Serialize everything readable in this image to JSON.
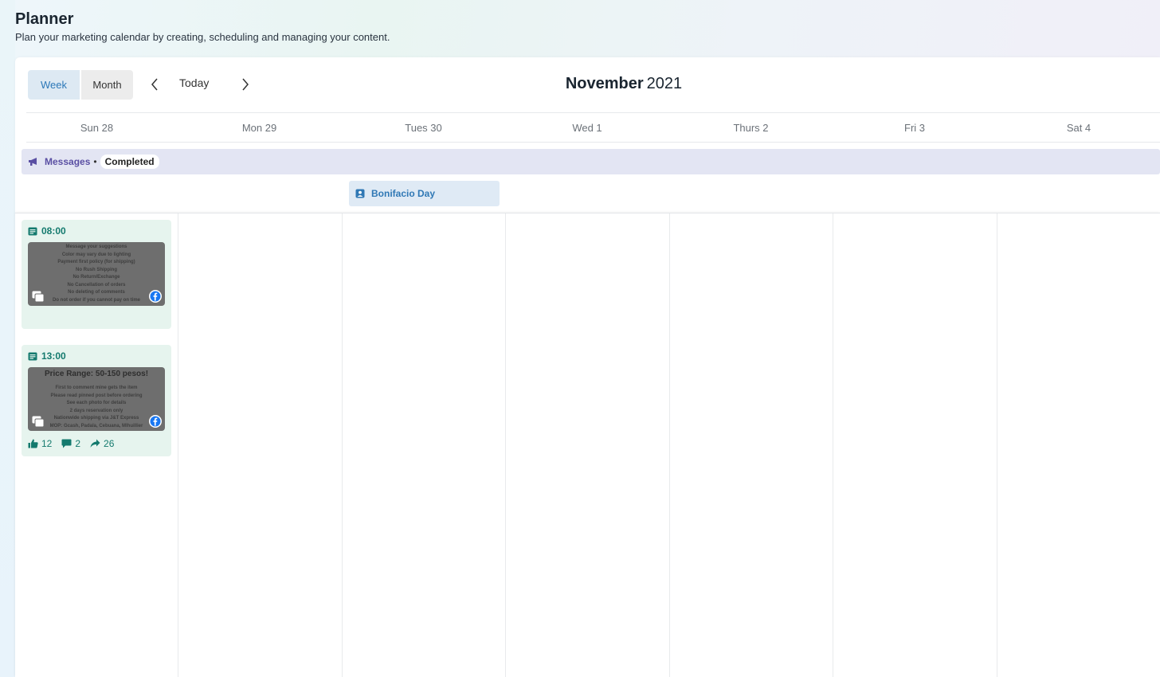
{
  "header": {
    "title": "Planner",
    "subtitle": "Plan your marketing calendar by creating, scheduling and managing your content."
  },
  "toolbar": {
    "views": [
      {
        "label": "Week",
        "active": true
      },
      {
        "label": "Month",
        "active": false
      }
    ],
    "today_label": "Today",
    "month": "November",
    "year": "2021",
    "prev_icon": "chevron-left-icon",
    "next_icon": "chevron-right-icon"
  },
  "days": [
    "Sun 28",
    "Mon 29",
    "Tues 30",
    "Wed 1",
    "Thurs 2",
    "Fri 3",
    "Sat 4"
  ],
  "messages": {
    "label": "Messages",
    "separator": "•",
    "status": "Completed",
    "icon": "megaphone-icon",
    "color": "#5a4fa3"
  },
  "holiday": {
    "label": "Bonifacio Day",
    "icon": "calendar-person-icon",
    "color": "#2f78b5"
  },
  "posts": [
    {
      "time": "08:00",
      "icon": "post-icon",
      "network": "facebook-icon",
      "thumb_title": "",
      "thumb_lines": [
        "Message your suggestions",
        "Color may vary due to lighting",
        "Payment first policy (for shipping)",
        "No Rush Shipping",
        "No Return/Exchange",
        "No Cancellation of orders",
        "No deleting of comments",
        "Do not order if you cannot pay on time"
      ],
      "stats": null
    },
    {
      "time": "13:00",
      "icon": "post-icon",
      "network": "facebook-icon",
      "thumb_title": "Price Range: 50-150 pesos!",
      "thumb_lines": [
        "First to comment mine gets the item",
        "Please read pinned post before ordering",
        "See each photo for details",
        "2 days reservation only",
        "Nationwide shipping via J&T Express",
        "MOP: Gcash, Padala, Cebuana, Mlhuillier"
      ],
      "stats": {
        "likes": "12",
        "comments": "2",
        "shares": "26"
      }
    }
  ],
  "colors": {
    "accent": "#2c78b8",
    "post_bg": "#e6f4ee",
    "post_text": "#147a6e",
    "messages_bg": "#e3e5f3",
    "holiday_bg": "#dfeaf5"
  }
}
